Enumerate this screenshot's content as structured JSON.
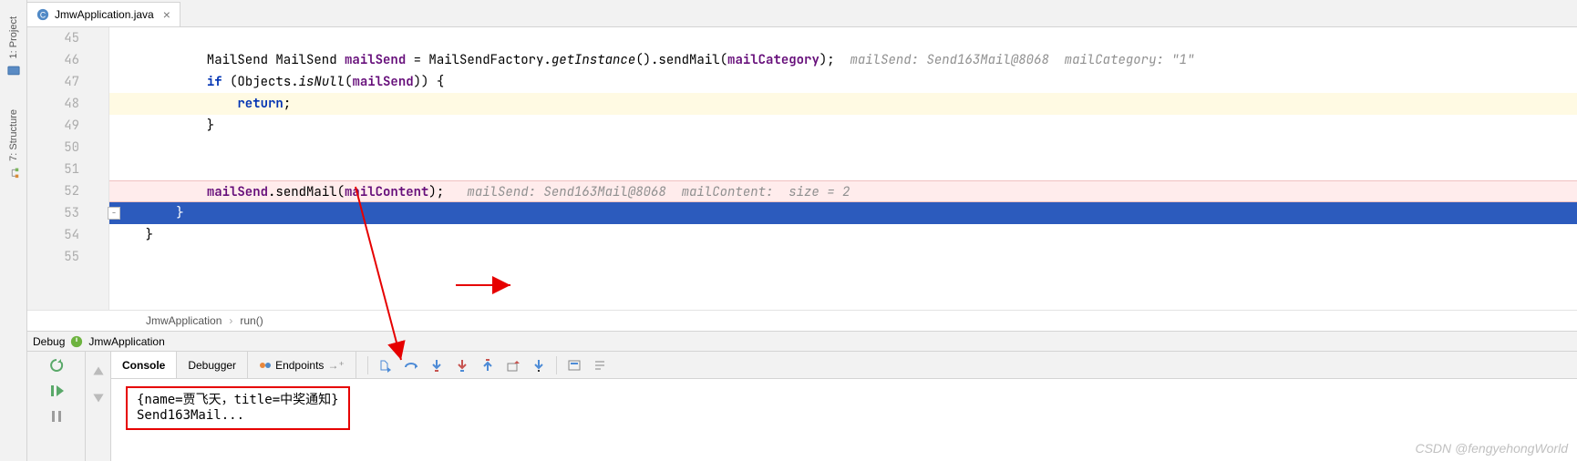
{
  "leftRail": {
    "project": "1: Project",
    "structure": "7: Structure"
  },
  "fileTab": {
    "name": "JmwApplication.java"
  },
  "gutter": [
    "45",
    "46",
    "47",
    "48",
    "49",
    "50",
    "51",
    "52",
    "53",
    "54",
    "55"
  ],
  "code": {
    "l46": {
      "pre": "            MailSend ",
      "var": "mailSend",
      "mid1": " = MailSendFactory.",
      "call": "getInstance",
      "mid2": "().sendMail(",
      "arg": "mailCategory",
      "end": ");",
      "hint": "  mailSend: Send163Mail@8068  mailCategory: \"1\""
    },
    "l47": {
      "pre": "            ",
      "kw": "if",
      "mid": " (Objects.",
      "fn": "isNull",
      "open": "(",
      "arg": "mailSend",
      "close": ")) {"
    },
    "l48": {
      "pre": "                ",
      "kw": "return",
      "end": ";"
    },
    "l49": "            }",
    "l52": {
      "pre": "            ",
      "obj": "mailSend",
      "mid": ".sendMail(",
      "arg": "mailContent",
      "end": ");",
      "hint": "   mailSend: Send163Mail@8068  mailContent:  size = 2"
    },
    "l53": "        }",
    "l54": "    }"
  },
  "breadcrumb": {
    "cls": "JmwApplication",
    "method": "run()"
  },
  "debugHeader": {
    "label": "Debug",
    "config": "JmwApplication"
  },
  "debugTabs": {
    "console": "Console",
    "debugger": "Debugger",
    "endpoints": "Endpoints"
  },
  "console": {
    "line1": "{name=贾飞天，title=中奖通知}",
    "line2": "Send163Mail..."
  },
  "watermark": "CSDN @fengyehongWorld",
  "icons": {
    "rerun": "rerun-icon",
    "resume": "resume-icon",
    "pause": "pause-icon",
    "showExec": "show-execution-point-icon",
    "stepOver": "step-over-icon",
    "stepInto": "step-into-icon",
    "forceStepInto": "force-step-into-icon",
    "stepOut": "step-out-icon",
    "dropFrame": "drop-frame-icon",
    "runToCursor": "run-to-cursor-icon",
    "evaluate": "evaluate-expression-icon",
    "trace": "trace-icon"
  }
}
